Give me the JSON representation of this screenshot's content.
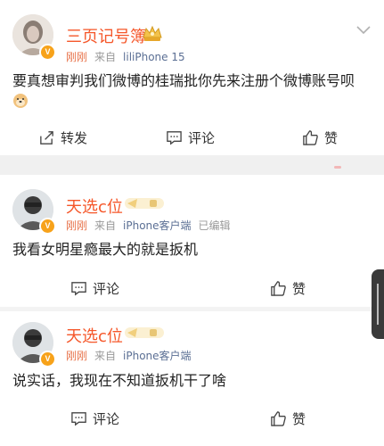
{
  "post": {
    "author": "三页记号簿",
    "time": "刚刚",
    "source_prefix": "来自",
    "source_name": "liliPhone 15",
    "text_line1": "要真想审判我们微博的桂瑞批你先来注册个微博账号呗",
    "repost_label": "转发",
    "comment_label": "评论",
    "like_label": "赞",
    "colors": {
      "name": "#f5572a",
      "time": "#e8734a",
      "badge": "#f7a21a"
    }
  },
  "comments": [
    {
      "author": "天选c位",
      "time": "刚刚",
      "source_prefix": "来自",
      "source_name": "iPhone客户端",
      "edited": "已编辑",
      "text": "我看女明星瘾最大的就是扳机",
      "comment_label": "评论",
      "like_label": "赞"
    },
    {
      "author": "天选c位",
      "time": "刚刚",
      "source_prefix": "来自",
      "source_name": "iPhone客户端",
      "text": "说实话，我现在不知道扳机干了啥",
      "comment_label": "评论",
      "like_label": "赞"
    }
  ],
  "icons": [
    "chevron-down-icon",
    "repost-icon",
    "comment-icon",
    "like-icon",
    "doge-emoji",
    "verified-v-icon",
    "fan-badge-icon"
  ]
}
